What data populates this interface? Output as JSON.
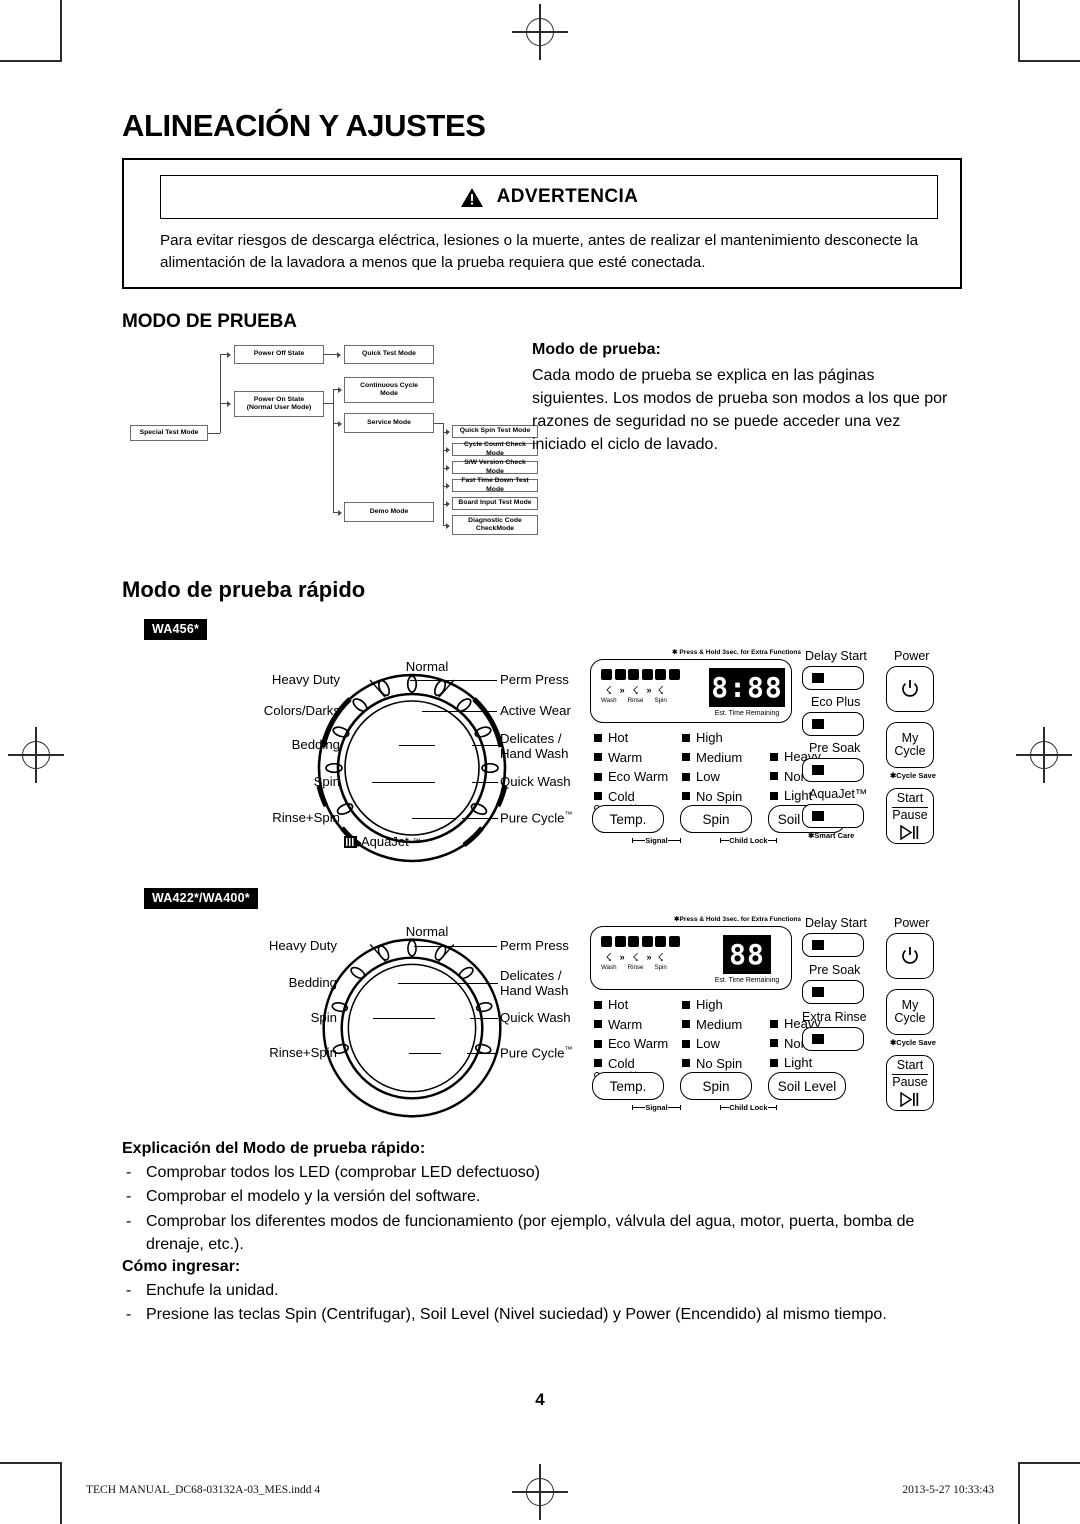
{
  "page": {
    "title": "ALINEACIÓN Y AJUSTES",
    "number": "4"
  },
  "warning": {
    "icon": "warning-triangle-icon",
    "heading": "ADVERTENCIA",
    "body": "Para evitar riesgos de descarga eléctrica, lesiones o la muerte, antes de realizar el mantenimiento desconecte la alimentación de la lavadora a menos que la prueba requiera que esté conectada."
  },
  "test_mode": {
    "heading": "MODO DE PRUEBA",
    "flow": {
      "root": "Special Test Mode",
      "power_off": "Power Off State",
      "quick_test": "Quick Test Mode",
      "power_on": "Power On State\n(Normal User Mode)",
      "power_on_l1": "Power On State",
      "power_on_l2": "(Normal User Mode)",
      "continuous_l1": "Continuous Cycle",
      "continuous_l2": "Mode",
      "service": "Service Mode",
      "demo": "Demo Mode",
      "service_children": [
        "Quick Spin Test Mode",
        "Cycle Count Check Mode",
        "S/W Version Check Mode",
        "Fast Time Down Test Mode",
        "Board Input Test Mode"
      ],
      "diagnostic_l1": "Diagnostic Code",
      "diagnostic_l2": "CheckMode"
    },
    "side": {
      "heading": "Modo de prueba:",
      "body": "Cada modo de prueba se explica en las páginas siguientes.  Los modos de prueba son modos a los que por razones de seguridad no se puede acceder una vez iniciado el ciclo de lavado."
    }
  },
  "quick_test": {
    "heading": "Modo de prueba rápido",
    "models": {
      "wa456": "WA456*",
      "wa422": "WA422*/WA400*"
    }
  },
  "panel_456": {
    "dial": {
      "top": "Normal",
      "left": [
        "Heavy Duty",
        "Colors/Darks",
        "Bedding",
        "Spin",
        "Rinse+Spin"
      ],
      "right_1": "Perm Press",
      "right_2": "Active Wear",
      "right_3_l1": "Delicates /",
      "right_3_l2": "Hand Wash",
      "right_4": "Quick Wash",
      "right_5": "Pure Cycle",
      "right_5_tm": "™",
      "aquajet": "AquaJet",
      "aquajet_tm": "™",
      "aquajet_icon": "aquajet-chip-icon"
    },
    "console": {
      "press_hold": "✱ Press & Hold 3sec. for Extra Functions",
      "status_icons": [
        "eco-icon",
        "delay-icon",
        "sound-icon",
        "lock-icon",
        "tub-clean-icon",
        "smart-care-icon"
      ],
      "cycle_stages": [
        "Wash",
        "Rinse",
        "Spin"
      ],
      "display_value": "8:88",
      "display_label": "Est. Time Remaining",
      "leds_temp": [
        "Hot",
        "Warm",
        "Eco Warm",
        "Cold"
      ],
      "leds_temp_sub": "Tap Cold",
      "leds_spin": [
        "High",
        "Medium",
        "Low",
        "No Spin"
      ],
      "leds_soil": [
        "Heavy",
        "Normal",
        "Light"
      ],
      "pill_buttons": [
        "Temp.",
        "Spin",
        "Soil Level"
      ],
      "brackets": [
        "Signal",
        "Child Lock"
      ],
      "fn_buttons": [
        {
          "label": "Delay Start",
          "sub": ""
        },
        {
          "label": "Eco Plus",
          "sub": ""
        },
        {
          "label": "Pre Soak",
          "sub": ""
        },
        {
          "label": "AquaJet™",
          "sub": "✱Smart Care"
        }
      ],
      "power_label": "Power",
      "power_icon": "power-icon",
      "mycycle_l1": "My",
      "mycycle_l2": "Cycle",
      "mycycle_sub": "✱Cycle Save",
      "start_l1": "Start",
      "start_l2": "Pause",
      "start_icon": "play-pause-icon"
    }
  },
  "panel_422": {
    "dial": {
      "top": "Normal",
      "left": [
        "Heavy Duty",
        "Bedding",
        "Spin",
        "Rinse+Spin"
      ],
      "right_1": "Perm Press",
      "right_2_l1": "Delicates /",
      "right_2_l2": "Hand Wash",
      "right_3": "Quick Wash",
      "right_4": "Pure Cycle",
      "right_4_tm": "™"
    },
    "console": {
      "press_hold": "✱Press & Hold 3sec. for Extra Functions",
      "status_icons": [
        "eco-icon",
        "delay-icon",
        "sound-icon",
        "lock-icon",
        "tub-clean-icon",
        "smart-care-icon"
      ],
      "cycle_stages": [
        "Wash",
        "Rinse",
        "Spin"
      ],
      "display_value": "88",
      "display_label": "Est. Time Remaining",
      "leds_temp": [
        "Hot",
        "Warm",
        "Eco Warm",
        "Cold"
      ],
      "leds_temp_sub": "Tap Cold",
      "leds_spin": [
        "High",
        "Medium",
        "Low",
        "No Spin"
      ],
      "leds_soil": [
        "Heavy",
        "Normal",
        "Light"
      ],
      "pill_buttons": [
        "Temp.",
        "Spin",
        "Soil Level"
      ],
      "brackets": [
        "Signal",
        "Child Lock"
      ],
      "fn_buttons": [
        {
          "label": "Delay Start",
          "sub": ""
        },
        {
          "label": "Pre Soak",
          "sub": ""
        },
        {
          "label": "Extra Rinse",
          "sub": ""
        }
      ],
      "power_label": "Power",
      "power_icon": "power-icon",
      "mycycle_l1": "My",
      "mycycle_l2": "Cycle",
      "mycycle_sub": "✱Cycle Save",
      "start_l1": "Start",
      "start_l2": "Pause",
      "start_icon": "play-pause-icon"
    }
  },
  "instructions": {
    "explain_heading": "Explicación del Modo de prueba rápido:",
    "explain_items": [
      "Comprobar todos los LED (comprobar LED defectuoso)",
      "Comprobar el modelo y la versión del software.",
      "Comprobar los diferentes modos de funcionamiento (por ejemplo, válvula del agua, motor, puerta, bomba de drenaje, etc.)."
    ],
    "enter_heading": "Cómo ingresar:",
    "enter_items": [
      "Enchufe la unidad.",
      "Presione las teclas Spin (Centrifugar), Soil Level (Nivel suciedad) y Power (Encendido) al mismo tiempo."
    ]
  },
  "footer": {
    "left": "TECH MANUAL_DC68-03132A-03_MES.indd  4",
    "right": "2013-5-27   10:33:43"
  }
}
